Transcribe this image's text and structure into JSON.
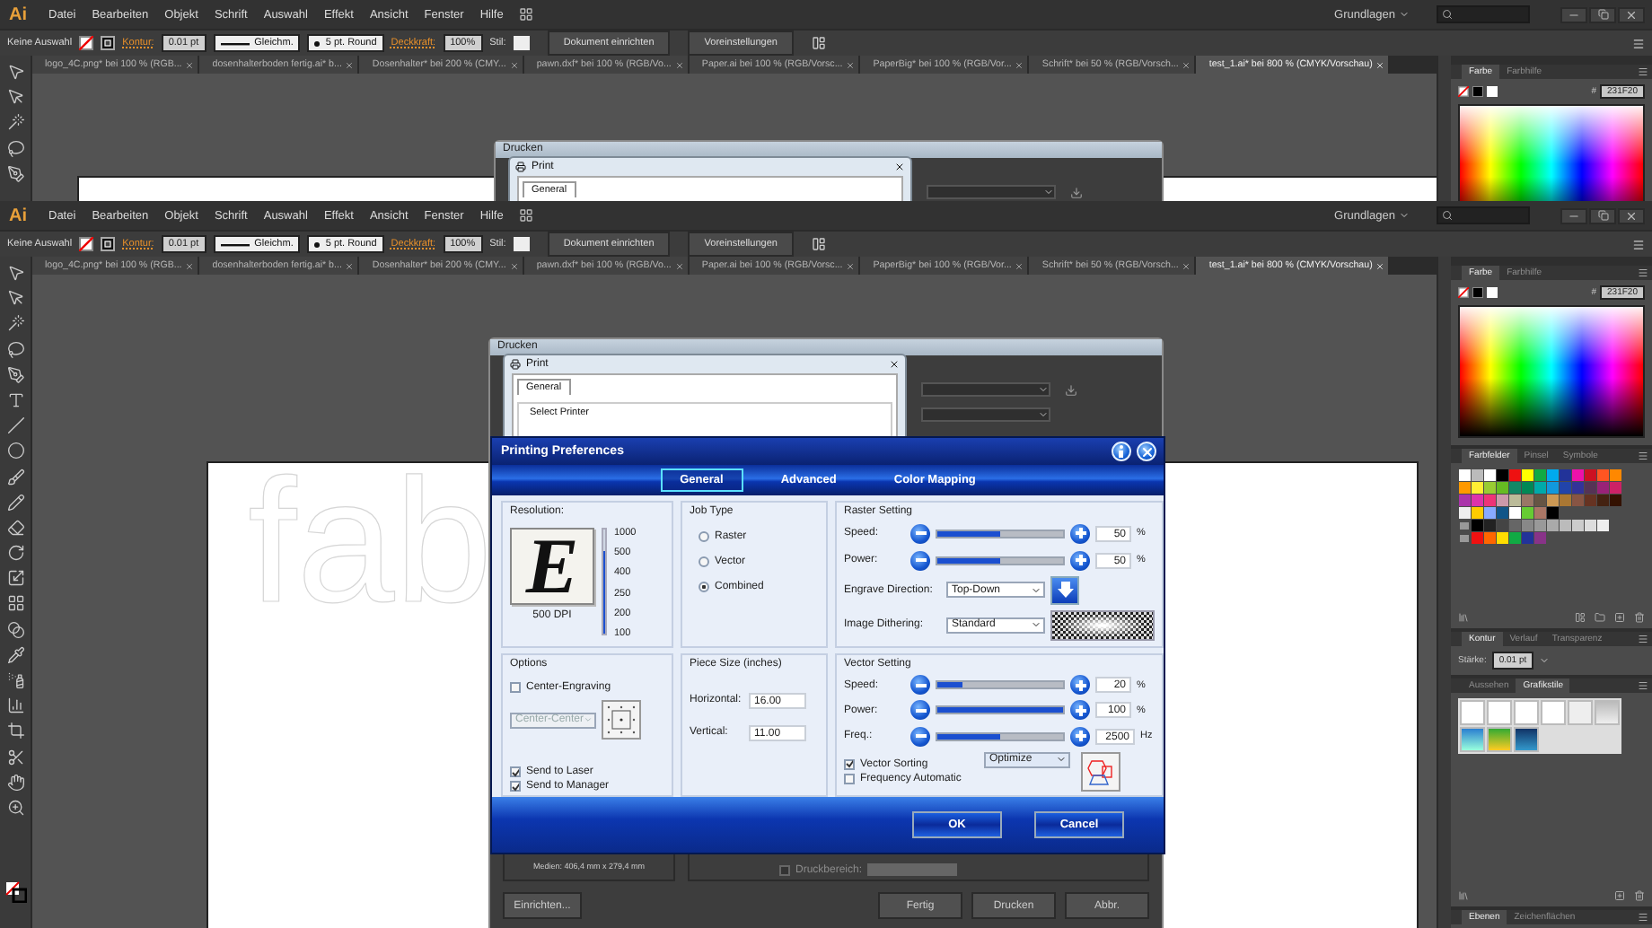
{
  "windows": [
    {
      "menubar": {
        "logo": "Ai",
        "items": [
          "Datei",
          "Bearbeiten",
          "Objekt",
          "Schrift",
          "Auswahl",
          "Effekt",
          "Ansicht",
          "Fenster",
          "Hilfe"
        ],
        "workspace": "Grundlagen"
      },
      "control_bar": {
        "selection": "Keine Auswahl",
        "stroke_label": "Kontur:",
        "stroke_weight": "0.01 pt",
        "profile": "Gleichm.",
        "brush": "5 pt. Round",
        "opacity_label": "Deckkraft:",
        "opacity": "100%",
        "style_label": "Stil:",
        "buttons": [
          "Dokument einrichten",
          "Voreinstellungen"
        ]
      },
      "tabs": [
        {
          "label": "logo_4C.png* bei 100 % (RGB...",
          "selected": false
        },
        {
          "label": "dosenhalterboden fertig.ai* b...",
          "selected": false
        },
        {
          "label": "Dosenhalter* bei 200 % (CMY...",
          "selected": false
        },
        {
          "label": "pawn.dxf* bei 100 % (RGB/Vo...",
          "selected": false
        },
        {
          "label": "Paper.ai bei 100 % (RGB/Vorsc...",
          "selected": false
        },
        {
          "label": "PaperBig* bei 100 % (RGB/Vor...",
          "selected": false
        },
        {
          "label": "Schrift* bei 50 % (RGB/Vorsch...",
          "selected": false
        },
        {
          "label": "test_1.ai* bei 800 % (CMYK/Vorschau)",
          "selected": true
        }
      ],
      "canvas": {
        "print_dialog": {
          "title": "Drucken",
          "print_window": {
            "title": "Print",
            "tabs": [
              {
                "label": "General",
                "selected": true
              }
            ]
          }
        }
      },
      "dock": {
        "panels": [
          {
            "kind": "color",
            "tabs": [
              {
                "label": "Farbe",
                "selected": true
              },
              {
                "label": "Farbhilfe",
                "selected": false
              }
            ],
            "hex_label": "#",
            "hex": "231F20"
          }
        ]
      }
    },
    {
      "menubar": {
        "logo": "Ai",
        "items": [
          "Datei",
          "Bearbeiten",
          "Objekt",
          "Schrift",
          "Auswahl",
          "Effekt",
          "Ansicht",
          "Fenster",
          "Hilfe"
        ],
        "workspace": "Grundlagen"
      },
      "control_bar": {
        "selection": "Keine Auswahl",
        "stroke_label": "Kontur:",
        "stroke_weight": "0.01 pt",
        "profile": "Gleichm.",
        "brush": "5 pt. Round",
        "opacity_label": "Deckkraft:",
        "opacity": "100%",
        "style_label": "Stil:",
        "buttons": [
          "Dokument einrichten",
          "Voreinstellungen"
        ]
      },
      "tabs": [
        {
          "label": "logo_4C.png* bei 100 % (RGB...",
          "selected": false
        },
        {
          "label": "dosenhalterboden fertig.ai* b...",
          "selected": false
        },
        {
          "label": "Dosenhalter* bei 200 % (CMY...",
          "selected": false
        },
        {
          "label": "pawn.dxf* bei 100 % (RGB/Vo...",
          "selected": false
        },
        {
          "label": "Paper.ai bei 100 % (RGB/Vorsc...",
          "selected": false
        },
        {
          "label": "PaperBig* bei 100 % (RGB/Vor...",
          "selected": false
        },
        {
          "label": "Schrift* bei 50 % (RGB/Vorsch...",
          "selected": false
        },
        {
          "label": "test_1.ai* bei 800 % (CMYK/Vorschau)",
          "selected": true
        }
      ],
      "canvas": {
        "artboard_text": "fab",
        "print_dialog": {
          "title": "Drucken",
          "print_window": {
            "title": "Print",
            "tabs": [
              {
                "label": "General",
                "selected": true
              }
            ],
            "group_label": "Select Printer"
          },
          "media": "Medien: 406,4 mm x 279,4 mm",
          "print_area": {
            "label": "Druckbereich:",
            "checked": false,
            "disabled": true
          },
          "buttons": [
            "Einrichten...",
            "Fertig",
            "Drucken",
            "Abbr."
          ]
        },
        "preferences": {
          "title": "Printing Preferences",
          "tabs": [
            {
              "label": "General",
              "selected": true
            },
            {
              "label": "Advanced",
              "selected": false
            },
            {
              "label": "Color Mapping",
              "selected": false
            }
          ],
          "resolution": {
            "label": "Resolution:",
            "preview": "E",
            "dpi": "500 DPI",
            "level": 0.8,
            "ticks": [
              "1000",
              "500",
              "400",
              "250",
              "200",
              "100"
            ]
          },
          "job_type": {
            "label": "Job Type",
            "options": [
              {
                "label": "Raster",
                "selected": false
              },
              {
                "label": "Vector",
                "selected": false
              },
              {
                "label": "Combined",
                "selected": true
              }
            ]
          },
          "raster": {
            "label": "Raster Setting",
            "sliders": [
              {
                "label": "Speed:",
                "level": 0.5,
                "value": "50",
                "unit": "%"
              },
              {
                "label": "Power:",
                "level": 0.5,
                "value": "50",
                "unit": "%"
              }
            ],
            "direction": {
              "label": "Engrave Direction:",
              "value": "Top-Down"
            },
            "dithering": {
              "label": "Image Dithering:",
              "value": "Standard"
            }
          },
          "options": {
            "label": "Options",
            "center": {
              "label": "Center-Engraving",
              "checked": false
            },
            "position": {
              "value": "Center-Center",
              "disabled": true
            },
            "checks": [
              {
                "label": "Send to Laser",
                "checked": true
              },
              {
                "label": "Send to Manager",
                "checked": true
              }
            ]
          },
          "piece_size": {
            "label": "Piece Size (inches)",
            "fields": [
              {
                "label": "Horizontal:",
                "value": "16.00"
              },
              {
                "label": "Vertical:",
                "value": "11.00"
              }
            ]
          },
          "vector": {
            "label": "Vector Setting",
            "sliders": [
              {
                "label": "Speed:",
                "level": 0.2,
                "value": "20",
                "unit": "%"
              },
              {
                "label": "Power:",
                "level": 1,
                "value": "100",
                "unit": "%"
              },
              {
                "label": "Freq.:",
                "level": 0.5,
                "value": "2500",
                "unit": "Hz"
              }
            ],
            "checks": [
              {
                "label": "Vector Sorting",
                "checked": true
              },
              {
                "label": "Frequency Automatic",
                "checked": false
              }
            ],
            "sorting": "Optimize"
          },
          "buttons": [
            "OK",
            "Cancel"
          ]
        }
      },
      "dock": {
        "panels": [
          {
            "kind": "color",
            "tabs": [
              {
                "label": "Farbe",
                "selected": true
              },
              {
                "label": "Farbhilfe",
                "selected": false
              }
            ],
            "hex_label": "#",
            "hex": "231F20"
          },
          {
            "kind": "swatches",
            "tabs": [
              {
                "label": "Farbfelder",
                "selected": true
              },
              {
                "label": "Pinsel",
                "selected": false
              },
              {
                "label": "Symbole",
                "selected": false
              }
            ]
          },
          {
            "kind": "stroke",
            "tabs": [
              {
                "label": "Kontur",
                "selected": true
              },
              {
                "label": "Verlauf",
                "selected": false
              },
              {
                "label": "Transparenz",
                "selected": false
              }
            ],
            "weight_label": "Stärke:",
            "weight": "0.01 pt"
          },
          {
            "kind": "styles",
            "tabs": [
              {
                "label": "Aussehen",
                "selected": false
              },
              {
                "label": "Grafikstile",
                "selected": true
              }
            ]
          },
          {
            "kind": "layers",
            "tabs": [
              {
                "label": "Ebenen",
                "selected": true
              },
              {
                "label": "Zeichenflächen",
                "selected": false
              }
            ]
          }
        ]
      }
    }
  ]
}
